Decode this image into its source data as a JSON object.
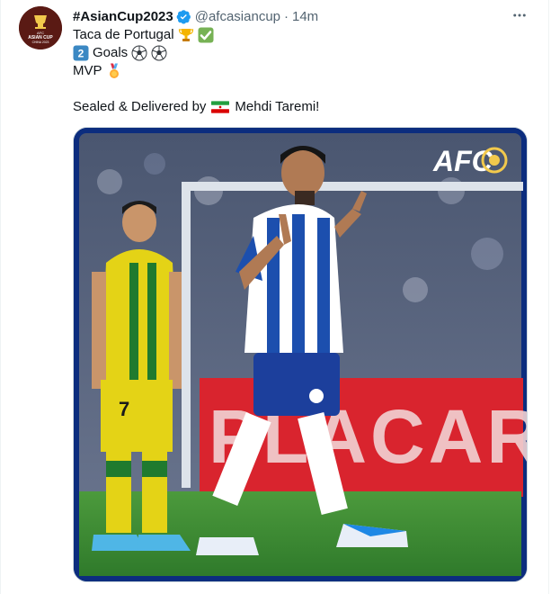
{
  "account": {
    "display_name": "#AsianCup2023",
    "handle": "@afcasiancup",
    "separator": "·",
    "time": "14m",
    "verified": true,
    "avatar_icon": "afc-asian-cup-logo-icon",
    "avatar_text_line1": "AFC",
    "avatar_text_line2": "ASIAN CUP",
    "avatar_text_line3": "CHINA 2023"
  },
  "tweet": {
    "line1": "Taca de Portugal",
    "line2": "Goals",
    "line2_badge": "2",
    "line3": "MVP",
    "line4_pre": "Sealed & Delivered by",
    "line4_post": "Mehdi Taremi!"
  },
  "media": {
    "logo_text": "AFC",
    "banner_text": "PLACARD",
    "player_left_number": "7"
  },
  "colors": {
    "text": "#0f1419",
    "secondary": "#536471",
    "verified": "#1d9bf0",
    "media_frame": "#0c2d7e",
    "pitch": "#3f8a3a",
    "banner": "#d9242e"
  },
  "more_icon": "more-horizontal-icon"
}
